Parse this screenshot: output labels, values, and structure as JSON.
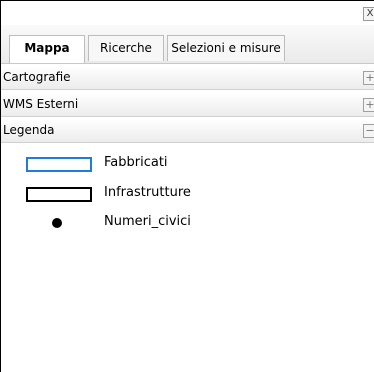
{
  "window": {
    "close_label": "X"
  },
  "tabs": [
    {
      "label": "Mappa"
    },
    {
      "label": "Ricerche"
    },
    {
      "label": "Selezioni e misure"
    }
  ],
  "sections": [
    {
      "label": "Cartografie",
      "toggle": "+"
    },
    {
      "label": "WMS Esterni",
      "toggle": "+"
    },
    {
      "label": "Legenda",
      "toggle": "−"
    }
  ],
  "legend": {
    "items": [
      {
        "label": "Fabbricati",
        "symbol": "outlined-rectangle",
        "color": "#1e7be0"
      },
      {
        "label": "Infrastrutture",
        "symbol": "outlined-rectangle",
        "color": "#000000"
      },
      {
        "label": "Numeri_civici",
        "symbol": "filled-dot",
        "color": "#000000"
      }
    ]
  }
}
